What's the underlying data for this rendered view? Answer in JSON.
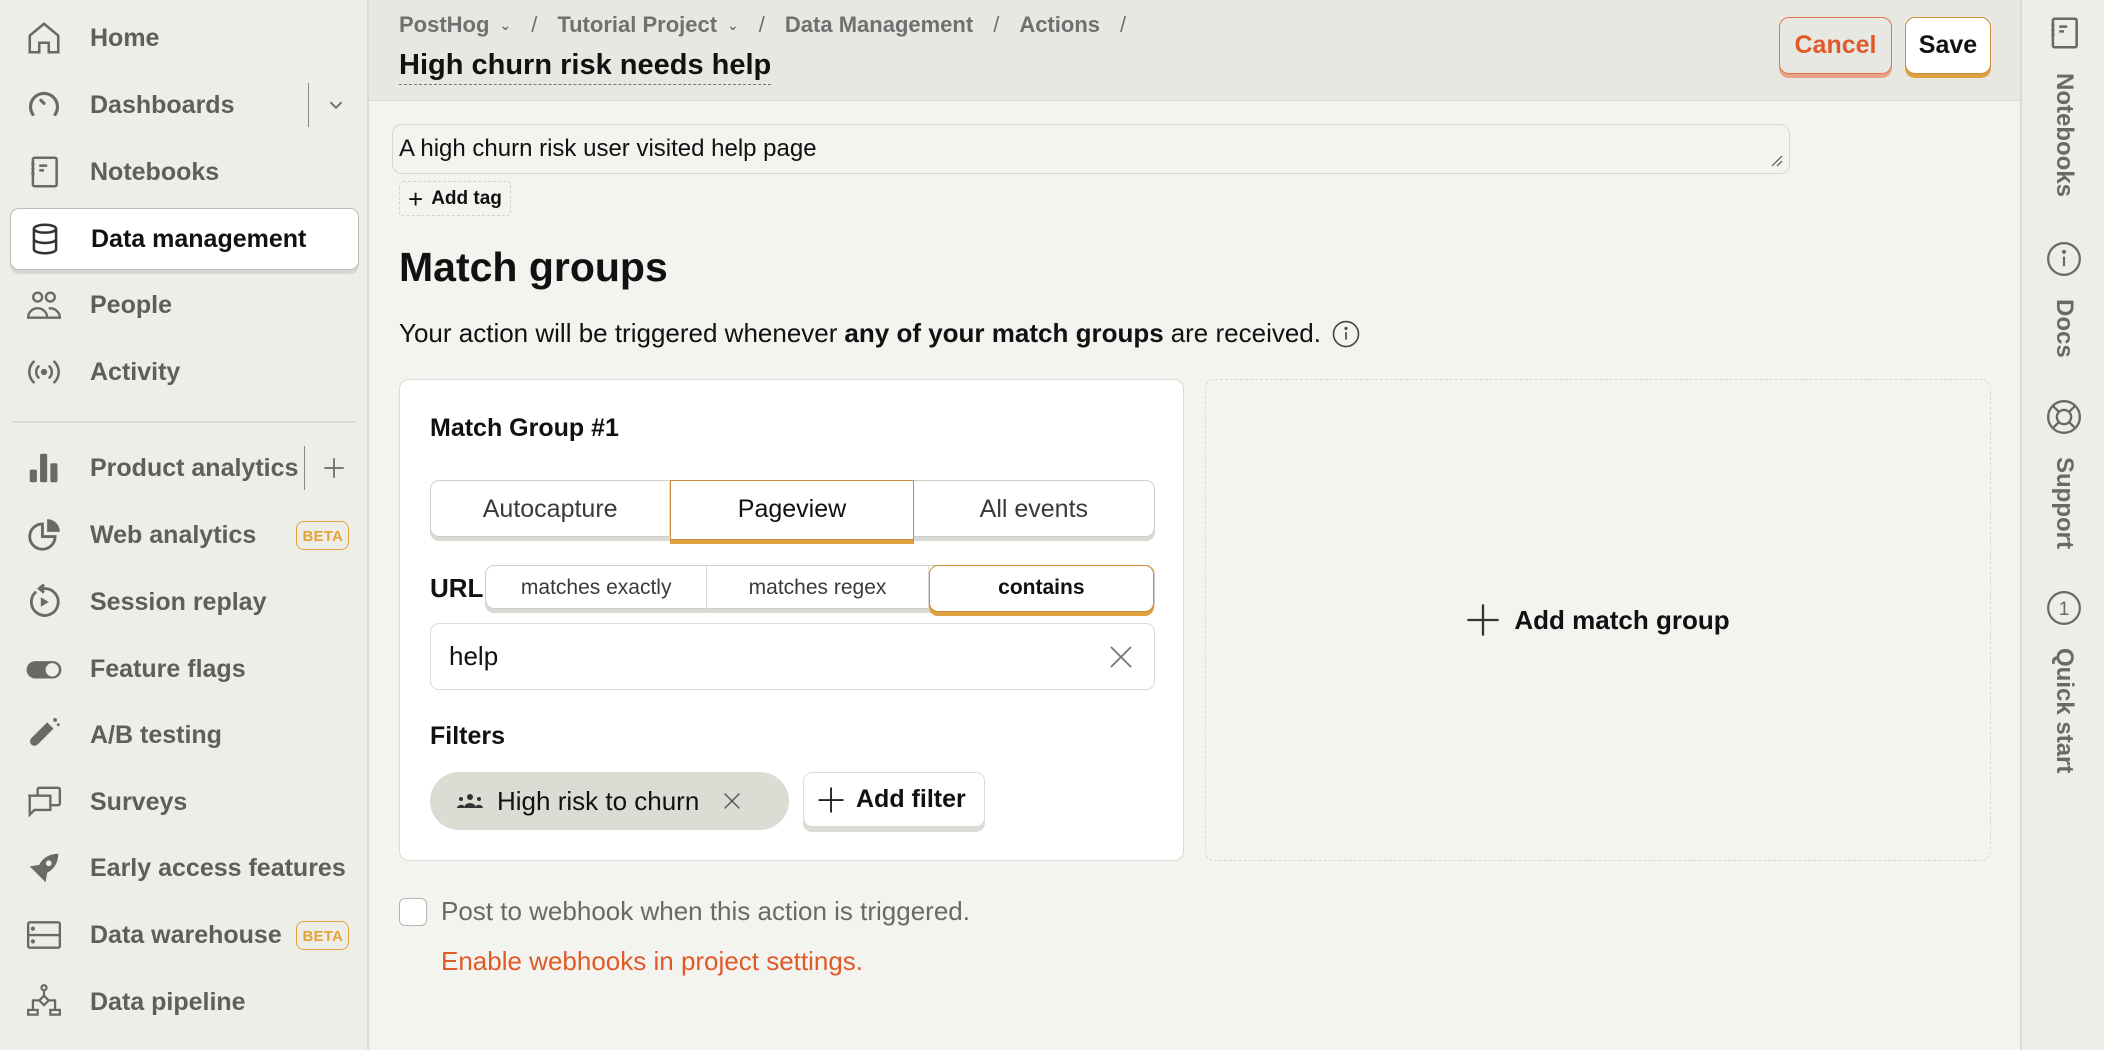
{
  "sidebar": {
    "items": [
      {
        "label": "Home",
        "icon": "home-icon"
      },
      {
        "label": "Dashboards",
        "icon": "dashboard-gauge-icon",
        "side": "chevron-down-icon"
      },
      {
        "label": "Notebooks",
        "icon": "notebook-icon"
      },
      {
        "label": "Data management",
        "icon": "database-icon",
        "active": true
      },
      {
        "label": "People",
        "icon": "people-icon"
      },
      {
        "label": "Activity",
        "icon": "broadcast-icon"
      },
      {
        "label": "Product analytics",
        "icon": "bar-chart-icon",
        "side": "plus-icon"
      },
      {
        "label": "Web analytics",
        "icon": "pie-chart-icon",
        "badge": "BETA"
      },
      {
        "label": "Session replay",
        "icon": "replay-icon"
      },
      {
        "label": "Feature flags",
        "icon": "toggle-icon"
      },
      {
        "label": "A/B testing",
        "icon": "flask-icon"
      },
      {
        "label": "Surveys",
        "icon": "chat-bubbles-icon"
      },
      {
        "label": "Early access features",
        "icon": "rocket-icon"
      },
      {
        "label": "Data warehouse",
        "icon": "server-icon",
        "badge": "BETA"
      },
      {
        "label": "Data pipeline",
        "icon": "pipeline-icon"
      }
    ]
  },
  "header": {
    "breadcrumb": [
      {
        "label": "PostHog",
        "dropdown": true
      },
      {
        "label": "Tutorial Project",
        "dropdown": true
      },
      {
        "label": "Data Management",
        "dropdown": false
      },
      {
        "label": "Actions",
        "dropdown": false
      }
    ],
    "title": "High churn risk needs help",
    "cancel_label": "Cancel",
    "save_label": "Save"
  },
  "rightbar": {
    "items": [
      {
        "label": "Notebooks",
        "icon": "notebook-icon"
      },
      {
        "label": "Docs",
        "icon": "info-icon"
      },
      {
        "label": "Support",
        "icon": "lifebuoy-icon"
      },
      {
        "label": "Quick start",
        "icon": "quickstart-badge-icon",
        "badge": "1"
      }
    ]
  },
  "main": {
    "description": "A high churn risk user visited help page",
    "add_tag_label": "Add tag",
    "match_groups_title": "Match groups",
    "subtitle_pre": "Your action will be triggered whenever",
    "subtitle_bold": "any of your match groups",
    "subtitle_post": "are received.",
    "group": {
      "title": "Match Group #1",
      "event_types": [
        "Autocapture",
        "Pageview",
        "All events"
      ],
      "event_selected": "Pageview",
      "url_label": "URL",
      "url_match_types": [
        "matches exactly",
        "matches regex",
        "contains"
      ],
      "url_match_selected": "contains",
      "url_value": "help",
      "filters_label": "Filters",
      "filter_chip": "High risk to churn",
      "add_filter_label": "Add filter"
    },
    "add_match_group_label": "Add match group",
    "webhook_label": "Post to webhook when this action is triggered.",
    "webhook_checked": false,
    "enable_webhooks_link": "Enable webhooks in project settings."
  },
  "colors": {
    "accent": "#e0a040",
    "danger": "#e05a28",
    "beta": "#e5a23a"
  }
}
